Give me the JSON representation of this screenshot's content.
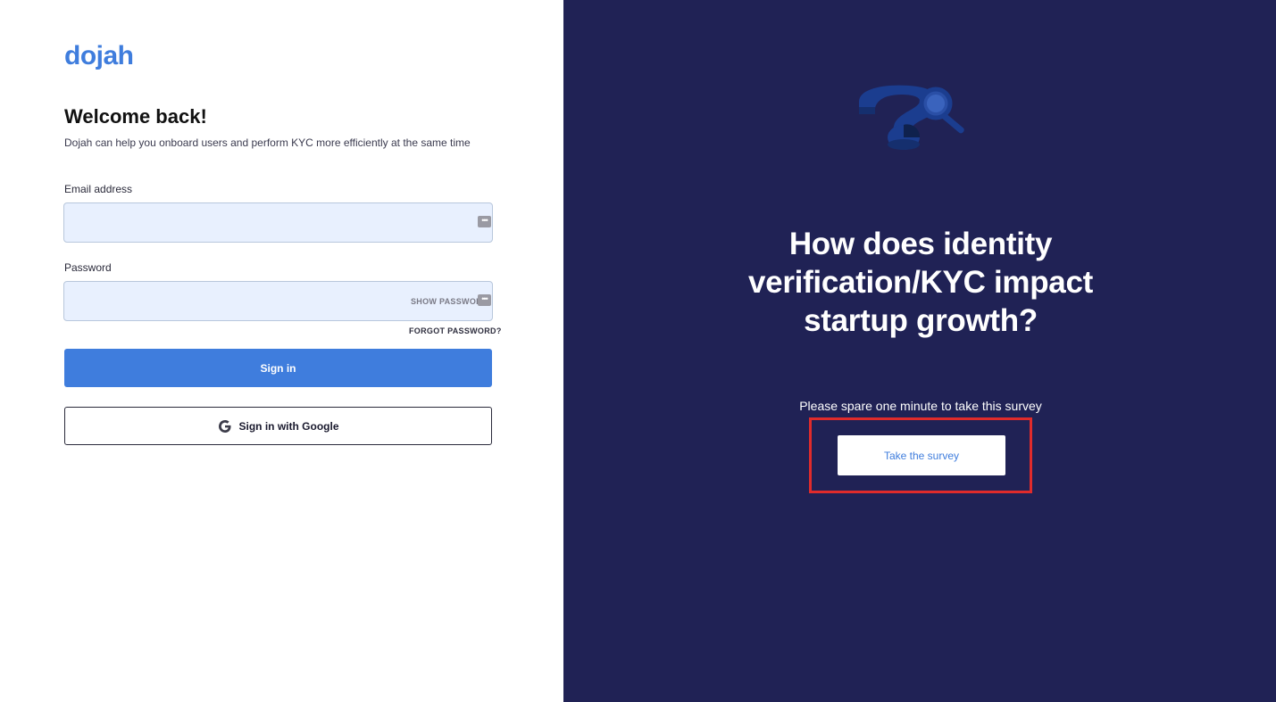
{
  "brand": {
    "logo_text": "dojah",
    "accent_color": "#3f7ddd",
    "panel_color": "#202255"
  },
  "login": {
    "title": "Welcome back!",
    "subtitle": "Dojah can help you onboard users and perform KYC more efficiently at the same time",
    "email_label": "Email address",
    "email_value": "",
    "password_label": "Password",
    "password_value": "",
    "show_password_label": "SHOW PASSWORD",
    "autofill_icon": "key-autofill-icon",
    "forgot_password_label": "FORGOT PASSWORD?",
    "signin_label": "Sign in",
    "google_signin_label": "Sign in with Google",
    "google_icon": "google-g-icon"
  },
  "promo": {
    "heading": "How does identity verification/KYC impact startup growth?",
    "subtext": "Please spare one minute to take this survey",
    "survey_button_label": "Take the survey",
    "illustration": "question-mark-magnifier-illustration",
    "highlight_color": "#e02b2b"
  }
}
